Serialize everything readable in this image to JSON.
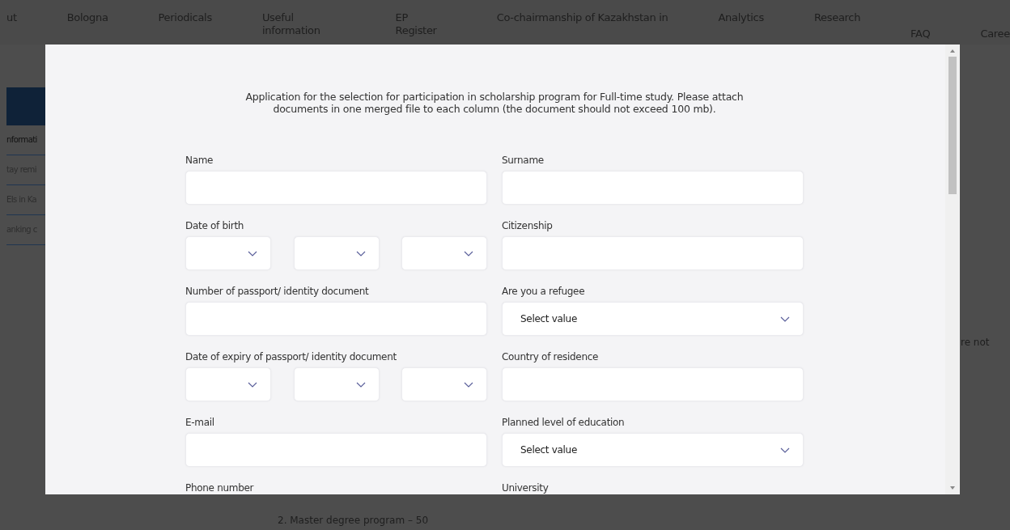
{
  "nav": {
    "items": [
      "ut",
      "Bologna",
      "Periodicals",
      "Useful information",
      "EP Register",
      "Co-chairmanship of Kazakhstan in",
      "Analytics",
      "Research",
      "FAQ",
      "Caree"
    ]
  },
  "sidebar": {
    "items": [
      {
        "label": "nformati",
        "selected": true
      },
      {
        "label": "tay remi",
        "selected": false
      },
      {
        "label": "EIs in Ka",
        "selected": false
      },
      {
        "label": "anking c",
        "selected": false
      }
    ]
  },
  "page": {
    "right_text": "re not",
    "bottom_text": "2. Master degree program – 50"
  },
  "modal": {
    "title": "Application for the selection for participation in scholarship program for Full-time study. Please attach documents in one merged file to each column (the document should not exceed 100 mb).",
    "fields": [
      {
        "label": "Name",
        "kind": "text"
      },
      {
        "label": "Surname",
        "kind": "text"
      },
      {
        "label": "Date of birth",
        "kind": "date"
      },
      {
        "label": "Citizenship",
        "kind": "text"
      },
      {
        "label": "Number of passport/ identity document",
        "kind": "text"
      },
      {
        "label": "Are you a refugee",
        "kind": "select",
        "placeholder": "Select value"
      },
      {
        "label": "Date of expiry of passport/ identity document",
        "kind": "date"
      },
      {
        "label": "Country of residence",
        "kind": "text"
      },
      {
        "label": "E-mail",
        "kind": "text"
      },
      {
        "label": "Planned level of education",
        "kind": "select",
        "placeholder": "Select value"
      },
      {
        "label": "Phone number",
        "kind": "label"
      },
      {
        "label": "University",
        "kind": "label"
      }
    ]
  }
}
